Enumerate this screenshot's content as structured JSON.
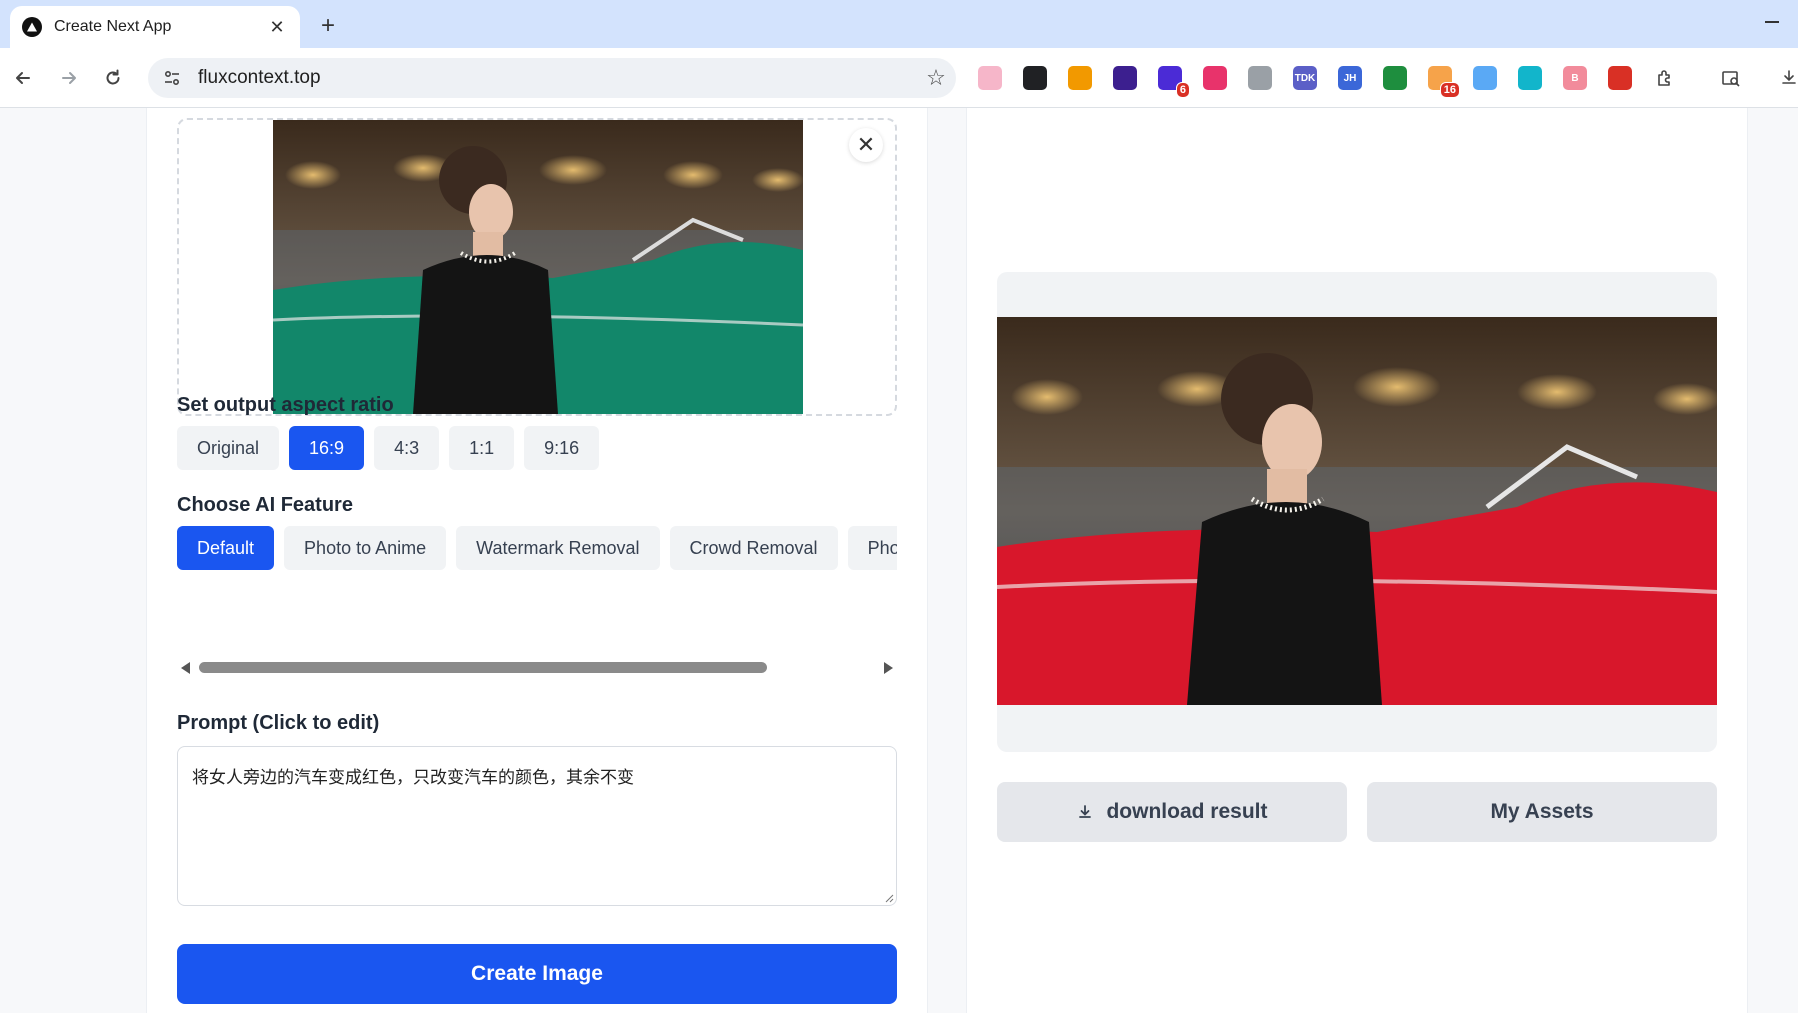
{
  "browser": {
    "tab_title": "Create Next App",
    "tab_close": "✕",
    "new_tab": "+",
    "url": "fluxcontext.top",
    "star": "☆",
    "extensions": [
      {
        "name": "ext-1",
        "bg": "#f6b6c9",
        "label": "",
        "badge": ""
      },
      {
        "name": "ext-2",
        "bg": "#202124",
        "label": "",
        "badge": ""
      },
      {
        "name": "ext-3",
        "bg": "#f29900",
        "label": "",
        "badge": ""
      },
      {
        "name": "ext-4",
        "bg": "#3c1f8f",
        "label": "",
        "badge": ""
      },
      {
        "name": "ext-5",
        "bg": "#4b2bd6",
        "label": "",
        "badge": "6"
      },
      {
        "name": "ext-6",
        "bg": "#e8336b",
        "label": "",
        "badge": ""
      },
      {
        "name": "ext-7",
        "bg": "#9aa0a6",
        "label": "",
        "badge": ""
      },
      {
        "name": "ext-8",
        "bg": "#5b5fc7",
        "label": "TDK",
        "badge": ""
      },
      {
        "name": "ext-9",
        "bg": "#3b67d8",
        "label": "JH",
        "badge": ""
      },
      {
        "name": "ext-10",
        "bg": "#1e8e3e",
        "label": "",
        "badge": ""
      },
      {
        "name": "ext-11",
        "bg": "#f6a34a",
        "label": "",
        "badge": "16"
      },
      {
        "name": "ext-12",
        "bg": "#5aa9f5",
        "label": "",
        "badge": ""
      },
      {
        "name": "ext-13",
        "bg": "#12b5cb",
        "label": "",
        "badge": ""
      },
      {
        "name": "ext-14",
        "bg": "#f28b9b",
        "label": "B",
        "badge": ""
      },
      {
        "name": "ext-15",
        "bg": "#d93025",
        "label": "",
        "badge": ""
      }
    ]
  },
  "editor": {
    "remove_icon": "✕",
    "aspect_title": "Set output aspect ratio",
    "aspect_options": [
      "Original",
      "16:9",
      "4:3",
      "1:1",
      "9:16"
    ],
    "aspect_selected": "16:9",
    "feature_title": "Choose AI Feature",
    "features": [
      "Default",
      "Photo to Anime",
      "Watermark Removal",
      "Crowd Removal",
      "Photo Restoration"
    ],
    "feature_selected": "Default",
    "prompt_title": "Prompt (Click to edit)",
    "prompt_value": "将女人旁边的汽车变成红色，只改变汽车的颜色，其余不变",
    "create_label": "Create Image"
  },
  "result": {
    "download_label": "download result",
    "assets_label": "My Assets"
  },
  "colors": {
    "accent": "#1a56f0",
    "source_car": "#12876a",
    "result_car": "#d8172b"
  }
}
